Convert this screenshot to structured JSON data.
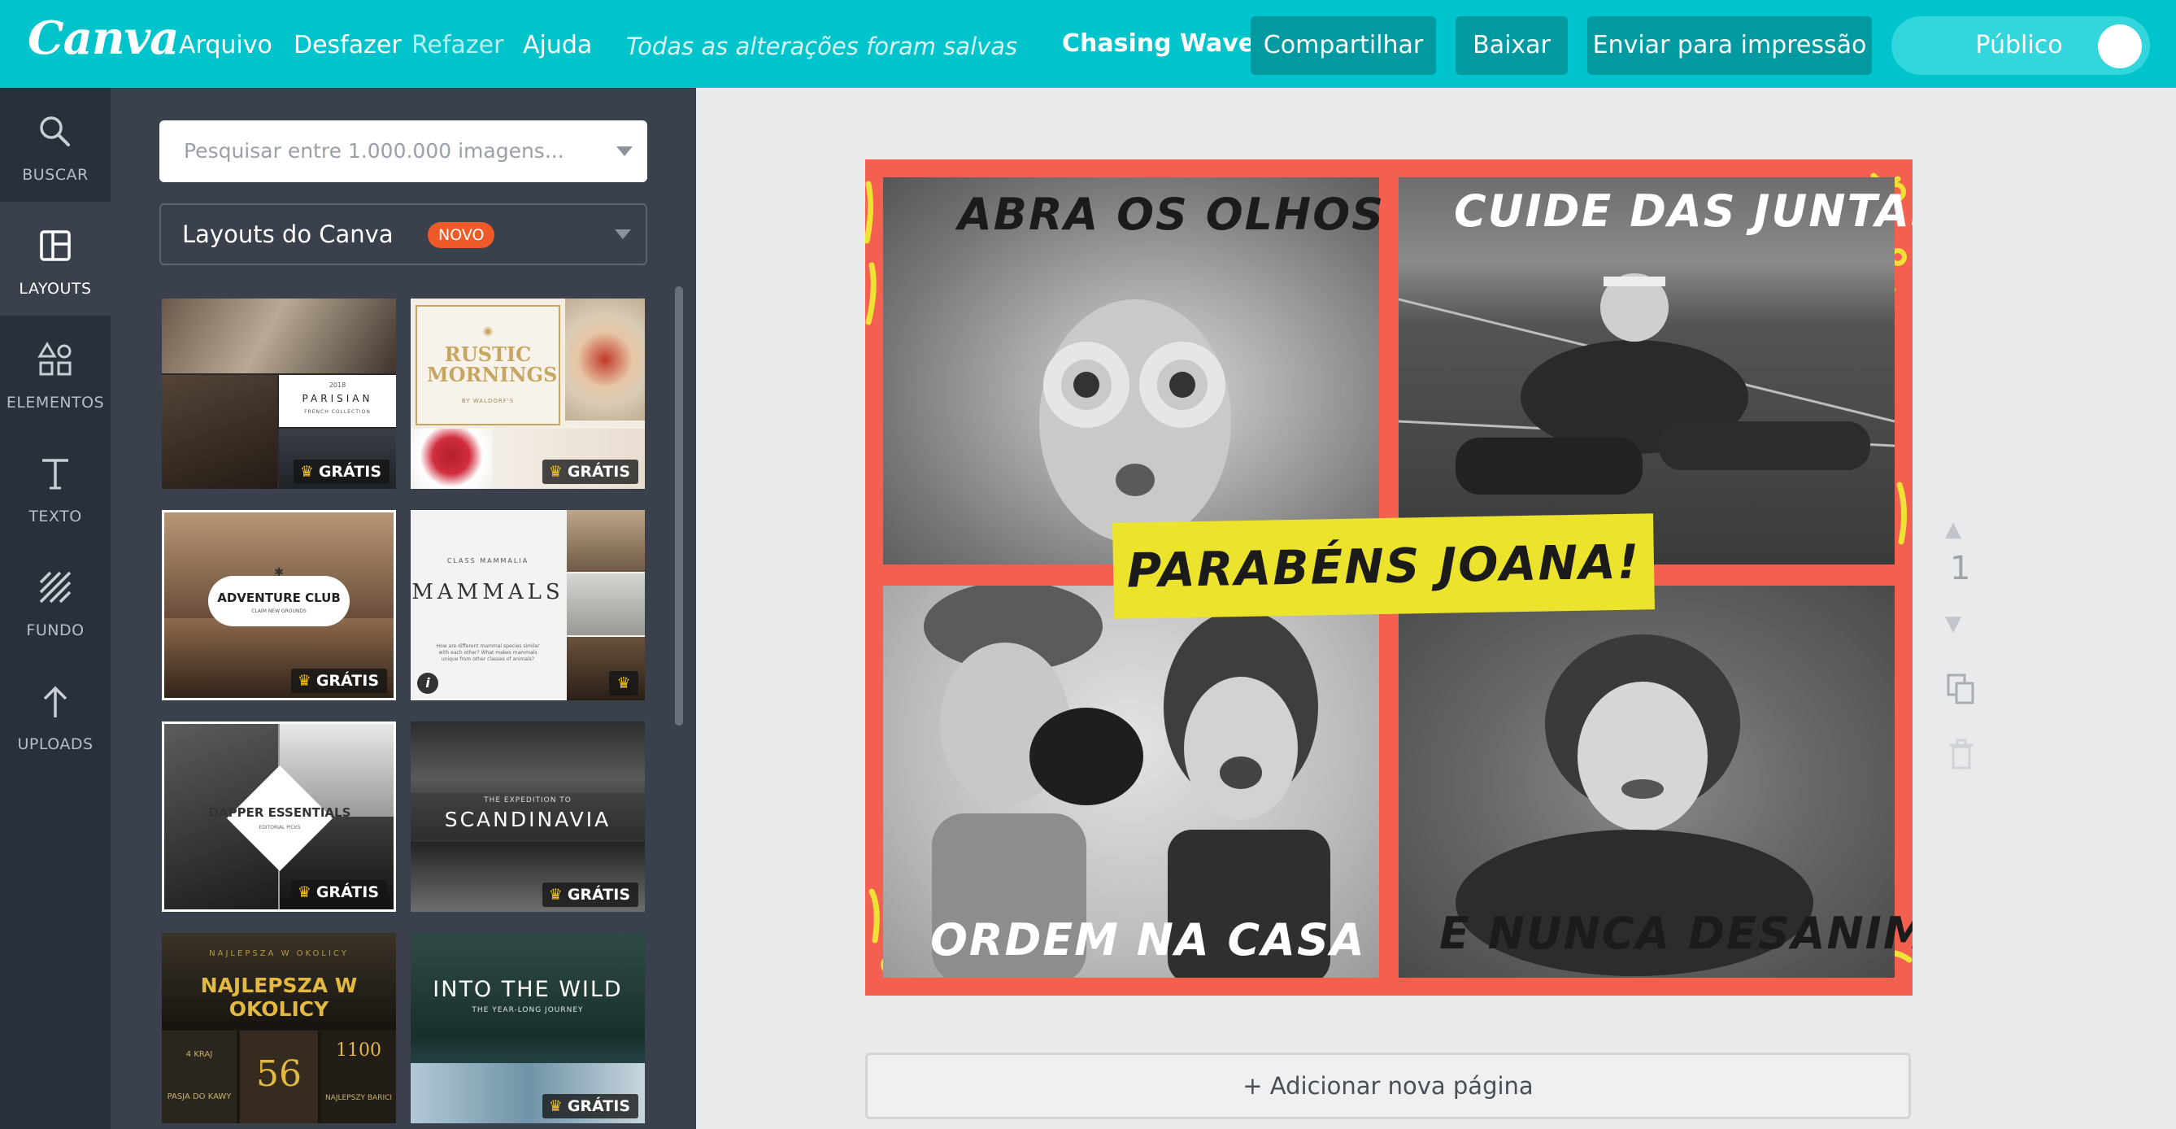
{
  "topbar": {
    "logo": "Canva",
    "menu": [
      "Arquivo",
      "Desfazer",
      "Refazer",
      "Ajuda"
    ],
    "save_status": "Todas as alterações foram salvas",
    "design_title": "Chasing Waves",
    "buttons": {
      "share": "Compartilhar",
      "download": "Baixar",
      "print": "Enviar para impressão"
    },
    "visibility": "Público"
  },
  "rail": [
    "BUSCAR",
    "LAYOUTS",
    "ELEMENTOS",
    "TEXTO",
    "FUNDO",
    "UPLOADS"
  ],
  "panel": {
    "search_placeholder": "Pesquisar entre 1.000.000 imagens...",
    "category": "Layouts do Canva",
    "category_badge": "NOVO",
    "free_label": "GRÁTIS",
    "thumbnails": [
      {
        "caption": "2018",
        "title": "PARISIAN",
        "subtitle": "FRENCH COLLECTION"
      },
      {
        "title": "RUSTIC MORNINGS",
        "subtitle": "BY WALDORF'S"
      },
      {
        "title": "ADVENTURE CLUB",
        "subtitle": "CLAIM NEW GROUNDS"
      },
      {
        "caption": "CLASS MAMMALIA",
        "title": "MAMMALS",
        "subtitle": "How are different mammal species similar with each other? What makes mammals unique from other classes of animals?"
      },
      {
        "title": "DAPPER ESSENTIALS",
        "subtitle": "EDITORIAL PICKS"
      },
      {
        "caption": "THE EXPEDITION TO",
        "title": "SCANDINAVIA"
      },
      {
        "caption": "NAJLEPSZA W OKOLICY",
        "title": "NAJLEPSZA W OKOLICY",
        "numbers": [
          "56",
          "1100"
        ],
        "labels": [
          "4 KRAJ",
          "PASJA DO KAWY",
          "NAJLEPSZY BARICI"
        ]
      },
      {
        "title": "INTO THE WILD",
        "subtitle": "THE YEAR-LONG JOURNEY"
      }
    ]
  },
  "design": {
    "captions": [
      "ABRA OS OLHOS",
      "CUIDE DAS JUNTAS",
      "ORDEM NA CASA",
      "E NUNCA DESANIME"
    ],
    "banner": "PARABÉNS JOANA!"
  },
  "page_number": "1",
  "add_page": "+ Adicionar nova página",
  "colors": {
    "topbar": "#00c4cc",
    "button": "#019aa0",
    "rail": "#293039",
    "panel": "#3a414c",
    "canvas_bg": "#e9eaec",
    "design_red": "#f36050",
    "banner_yellow": "#ece32d"
  }
}
